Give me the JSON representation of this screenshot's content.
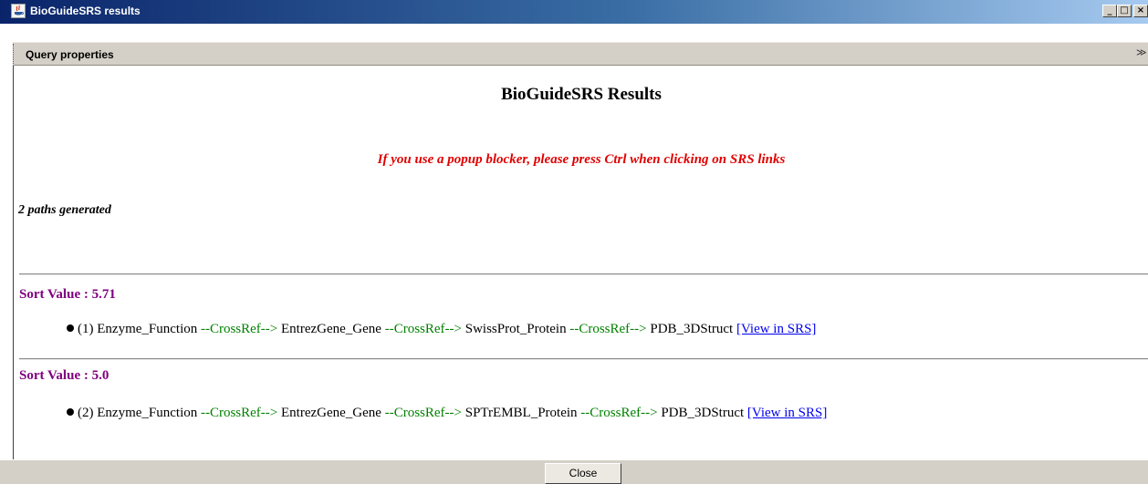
{
  "window": {
    "title": "BioGuideSRS results",
    "minimize_label": "_",
    "maximize_label": "□",
    "close_label": "×"
  },
  "query_bar": {
    "label": "Query properties",
    "collapse_glyph": "≫"
  },
  "content": {
    "title": "BioGuideSRS Results",
    "popup_notice": "If you use a popup blocker, please press Ctrl when clicking on SRS links",
    "paths_count": "2 paths generated",
    "results": [
      {
        "sort_value": "Sort Value : 5.71",
        "index": "(1)",
        "path": [
          "Enzyme_Function",
          "EntrezGene_Gene",
          "SwissProt_Protein",
          "PDB_3DStruct"
        ],
        "relation": "--CrossRef-->",
        "link": "[View in SRS]"
      },
      {
        "sort_value": "Sort Value : 5.0",
        "index": "(2)",
        "path": [
          "Enzyme_Function",
          "EntrezGene_Gene",
          "SPTrEMBL_Protein",
          "PDB_3DStruct"
        ],
        "relation": "--CrossRef-->",
        "link": "[View in SRS]"
      }
    ]
  },
  "footer": {
    "close_button": "Close"
  },
  "colors": {
    "title_bar_start": "#0a246a",
    "notice": "#e00000",
    "sort_value": "#800080",
    "relation": "#008000",
    "link": "#0000ee",
    "chrome": "#d4d0c8"
  }
}
